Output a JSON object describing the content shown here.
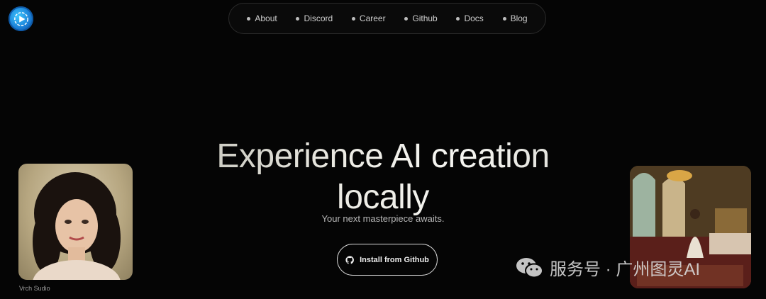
{
  "brand": {
    "logo_icon": "play-logo-icon"
  },
  "nav": {
    "items": [
      {
        "label": "About"
      },
      {
        "label": "Discord"
      },
      {
        "label": "Career"
      },
      {
        "label": "Github"
      },
      {
        "label": "Docs"
      },
      {
        "label": "Blog"
      }
    ]
  },
  "hero": {
    "title_line1": "Experience AI creation",
    "title_line2": "locally",
    "subtitle": "Your next masterpiece awaits.",
    "cta_label": "Install from Github",
    "cta_icon": "github-icon"
  },
  "cards": {
    "left_caption": "Vrch Sudio"
  },
  "watermark": {
    "text": "服务号 · 广州图灵AI",
    "icon": "wechat-icon"
  }
}
